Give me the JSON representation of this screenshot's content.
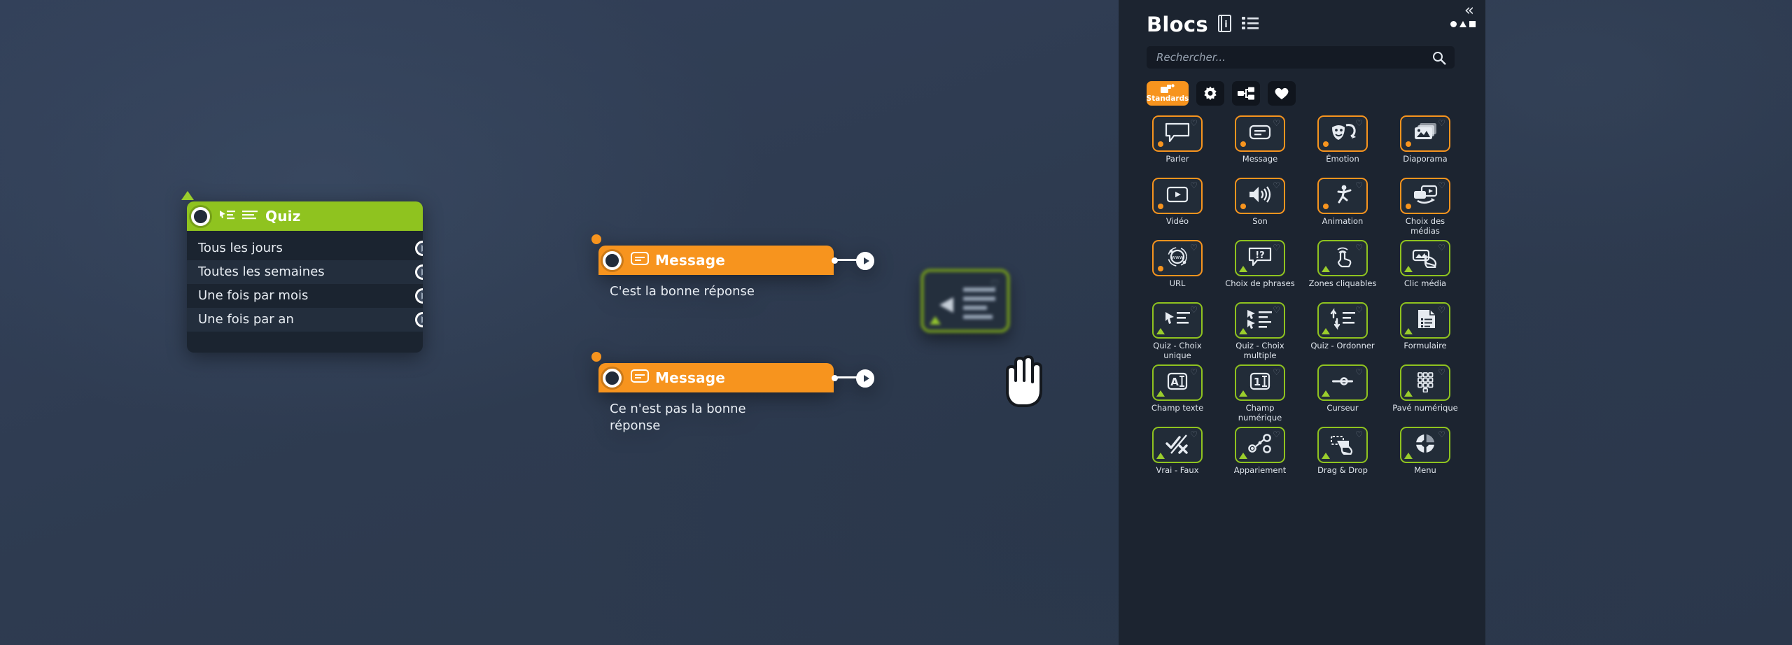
{
  "panel": {
    "title": "Blocs",
    "collapse_label": "«",
    "header_icons": [
      {
        "name": "info-book-icon",
        "glyph": "i"
      },
      {
        "name": "list-view-icon",
        "glyph": "list"
      }
    ],
    "shapes_menu": {
      "name": "shapes-menu",
      "glyph": "●▲■"
    },
    "search": {
      "placeholder": "Rechercher...",
      "value": "",
      "icon": "search-icon"
    },
    "filters": [
      {
        "name": "filter-standards",
        "label": "Standards",
        "icon": "blocks-icon",
        "active": true
      },
      {
        "name": "filter-settings",
        "label": "",
        "icon": "gear-icon",
        "active": false
      },
      {
        "name": "filter-structure",
        "label": "",
        "icon": "sitemap-icon",
        "active": false
      },
      {
        "name": "filter-favorites",
        "label": "",
        "icon": "heart-icon",
        "active": false
      }
    ],
    "blocks": [
      {
        "label": "Parler",
        "icon": "speech-bubble-icon",
        "color": "orange",
        "marker": "dot"
      },
      {
        "label": "Message",
        "icon": "message-card-icon",
        "color": "orange",
        "marker": "dot"
      },
      {
        "label": "Émotion",
        "icon": "theater-masks-icon",
        "color": "orange",
        "marker": "dot"
      },
      {
        "label": "Diaporama",
        "icon": "slideshow-icon",
        "color": "orange",
        "marker": "dot"
      },
      {
        "label": "Vidéo",
        "icon": "video-play-icon",
        "color": "orange",
        "marker": "dot"
      },
      {
        "label": "Son",
        "icon": "speaker-icon",
        "color": "orange",
        "marker": "dot"
      },
      {
        "label": "Animation",
        "icon": "running-person-icon",
        "color": "orange",
        "marker": "dot"
      },
      {
        "label": "Choix des médias",
        "icon": "media-choice-icon",
        "color": "orange",
        "marker": "dot"
      },
      {
        "label": "URL",
        "icon": "www-globe-icon",
        "color": "orange",
        "marker": "dot"
      },
      {
        "label": "Choix de phrases",
        "icon": "question-bubble-icon",
        "color": "green",
        "marker": "triangle"
      },
      {
        "label": "Zones cliquables",
        "icon": "tap-hand-icon",
        "color": "green",
        "marker": "triangle"
      },
      {
        "label": "Clic média",
        "icon": "media-click-icon",
        "color": "green",
        "marker": "triangle"
      },
      {
        "label": "Quiz - Choix unique",
        "icon": "single-choice-icon",
        "color": "green",
        "marker": "triangle"
      },
      {
        "label": "Quiz - Choix multiple",
        "icon": "multi-choice-icon",
        "color": "green",
        "marker": "triangle"
      },
      {
        "label": "Quiz - Ordonner",
        "icon": "reorder-arrows-icon",
        "color": "green",
        "marker": "triangle"
      },
      {
        "label": "Formulaire",
        "icon": "form-document-icon",
        "color": "green",
        "marker": "triangle"
      },
      {
        "label": "Champ texte",
        "icon": "text-field-icon",
        "color": "green",
        "marker": "triangle"
      },
      {
        "label": "Champ numérique",
        "icon": "number-field-icon",
        "color": "green",
        "marker": "triangle"
      },
      {
        "label": "Curseur",
        "icon": "slider-icon",
        "color": "green",
        "marker": "triangle"
      },
      {
        "label": "Pavé numérique",
        "icon": "keypad-icon",
        "color": "green",
        "marker": "triangle"
      },
      {
        "label": "Vrai - Faux",
        "icon": "check-cross-icon",
        "color": "green",
        "marker": "triangle"
      },
      {
        "label": "Appariement",
        "icon": "matching-nodes-icon",
        "color": "green",
        "marker": "triangle"
      },
      {
        "label": "Drag & Drop",
        "icon": "drag-drop-icon",
        "color": "green",
        "marker": "triangle"
      },
      {
        "label": "Menu",
        "icon": "pie-menu-icon",
        "color": "green",
        "marker": "triangle"
      }
    ]
  },
  "canvas": {
    "quiz_node": {
      "title": "Quiz",
      "header_icons": [
        "single-choice-icon",
        "text-lines-icon"
      ],
      "answers": [
        {
          "label": "Tous les jours"
        },
        {
          "label": "Toutes les semaines"
        },
        {
          "label": "Une fois par mois"
        },
        {
          "label": "Une fois par an"
        }
      ]
    },
    "message_nodes": [
      {
        "title": "Message",
        "text": "C'est la bonne réponse",
        "icon": "message-card-icon"
      },
      {
        "title": "Message",
        "text": "Ce n'est pas la bonne réponse",
        "icon": "message-card-icon"
      }
    ],
    "dragged_block": {
      "label": "Quiz - Choix unique",
      "cursor": "grab-hand-cursor"
    }
  },
  "colors": {
    "accent_orange": "#f7941e",
    "accent_green": "#8fc31f",
    "panel_bg": "#1c2430",
    "canvas_bg": "#2e3b50",
    "node_body": "#1b2430"
  }
}
